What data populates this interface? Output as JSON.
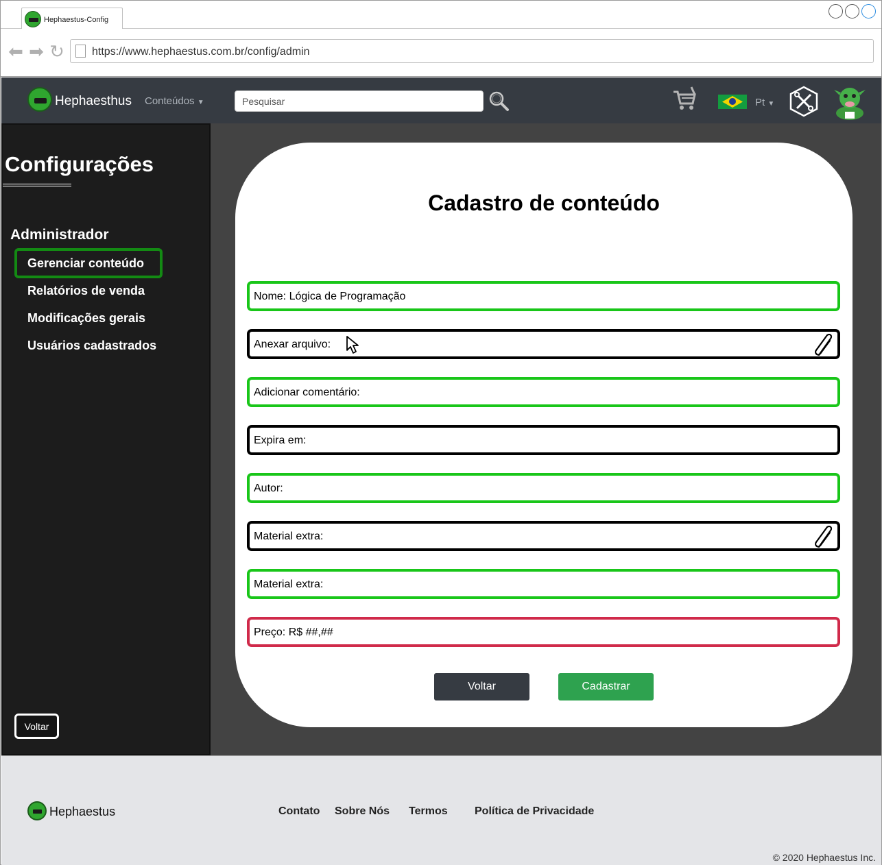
{
  "browser": {
    "tab_title": "Hephaestus-Config",
    "url": "https://www.hephaestus.com.br/config/admin"
  },
  "navbar": {
    "brand": "Hephaesthus",
    "menu_conteudos": "Conteúdos",
    "search_placeholder": "Pesquisar",
    "language": "Pt"
  },
  "sidebar": {
    "title": "Configurações",
    "section": "Administrador",
    "items": [
      {
        "label": "Gerenciar conteúdo",
        "active": true
      },
      {
        "label": "Relatórios de venda"
      },
      {
        "label": "Modificações gerais"
      },
      {
        "label": "Usuários cadastrados"
      }
    ],
    "back_button": "Voltar"
  },
  "form": {
    "title": "Cadastro de conteúdo",
    "fields": [
      {
        "label": "Nome: Lógica de Programação",
        "border": "green"
      },
      {
        "label": "Anexar arquivo:",
        "border": "black",
        "icon": "paperclip-icon"
      },
      {
        "label": "Adicionar comentário:",
        "border": "green"
      },
      {
        "label": "Expira em:",
        "border": "black"
      },
      {
        "label": "Autor:",
        "border": "green"
      },
      {
        "label": "Material extra:",
        "border": "black",
        "icon": "paperclip-icon"
      },
      {
        "label": "Material extra:",
        "border": "green"
      },
      {
        "label": "Preço: R$ ##,##",
        "border": "red"
      }
    ],
    "buttons": {
      "back": "Voltar",
      "submit": "Cadastrar"
    }
  },
  "footer": {
    "brand": "Hephaestus",
    "links": [
      "Contato",
      "Sobre Nós",
      "Termos",
      "Política de Privacidade"
    ],
    "copyright": "© 2020 Hephaestus Inc."
  },
  "colors": {
    "nav_bg": "#363b42",
    "sidebar_bg": "#1c1c1c",
    "main_bg": "#434343",
    "green_border": "#19c619",
    "red_border": "#d02a4a",
    "submit_green": "#2ea24f",
    "active_item": "#138a13"
  }
}
